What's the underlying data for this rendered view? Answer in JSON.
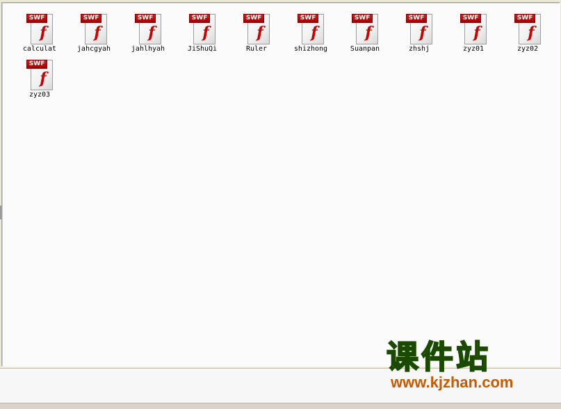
{
  "files": [
    {
      "name": "calculat",
      "badge": "SWF",
      "glyph": "f"
    },
    {
      "name": "jahcgyah",
      "badge": "SWF",
      "glyph": "f"
    },
    {
      "name": "jahlhyah",
      "badge": "SWF",
      "glyph": "f"
    },
    {
      "name": "JiShuQi",
      "badge": "SWF",
      "glyph": "f"
    },
    {
      "name": "Ruler",
      "badge": "SWF",
      "glyph": "f"
    },
    {
      "name": "shizhong",
      "badge": "SWF",
      "glyph": "f"
    },
    {
      "name": "Suanpan",
      "badge": "SWF",
      "glyph": "f"
    },
    {
      "name": "zhshj",
      "badge": "SWF",
      "glyph": "f"
    },
    {
      "name": "zyz01",
      "badge": "SWF",
      "glyph": "f"
    },
    {
      "name": "zyz02",
      "badge": "SWF",
      "glyph": "f"
    },
    {
      "name": "zyz03",
      "badge": "SWF",
      "glyph": "f"
    }
  ],
  "watermark": {
    "title": "课件站",
    "url": "www.kjzhan.com"
  },
  "colors": {
    "pane_background": "#fbfbfb",
    "swf_badge": "#c80000",
    "watermark_title": "#f2e200",
    "watermark_url": "#c85a00"
  },
  "icons": {
    "file_icon": "swf-flash-file-icon"
  }
}
